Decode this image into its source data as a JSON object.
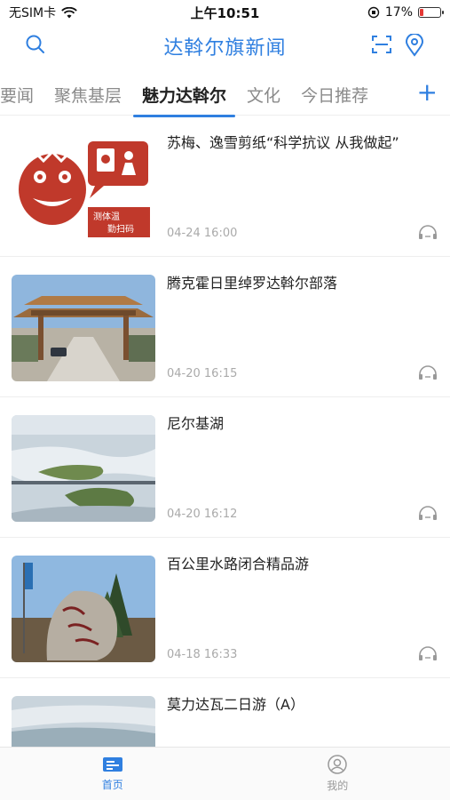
{
  "status_bar": {
    "carrier": "无SIM卡",
    "time": "上午10:51",
    "battery": "17%",
    "battery_level": 0.17,
    "battery_color": "#e53935"
  },
  "header": {
    "title": "达斡尔旗新闻",
    "accent_color": "#2f7fe0",
    "icons": [
      "search-icon",
      "scan-icon",
      "location-icon"
    ]
  },
  "tabs": {
    "items": [
      "要闻",
      "聚焦基层",
      "魅力达斡尔",
      "文化",
      "今日推荐"
    ],
    "active_index": 2,
    "add_icon": "plus-icon"
  },
  "news": [
    {
      "title": "苏梅、逸雪剪纸“科学抗议 从我做起”",
      "time": "04-24 16:00",
      "thumb_text": [
        "测体温",
        "勤扫码"
      ]
    },
    {
      "title": "腾克霍日里绰罗达斡尔部落",
      "time": "04-20 16:15"
    },
    {
      "title": "尼尔基湖",
      "time": "04-20 16:12"
    },
    {
      "title": "百公里水路闭合精品游",
      "time": "04-18 16:33"
    },
    {
      "title": "莫力达瓦二日游（A）",
      "time": ""
    }
  ],
  "bottom_nav": {
    "items": [
      {
        "label": "首页",
        "icon": "home-icon",
        "active": true
      },
      {
        "label": "我的",
        "icon": "profile-icon",
        "active": false
      }
    ]
  }
}
